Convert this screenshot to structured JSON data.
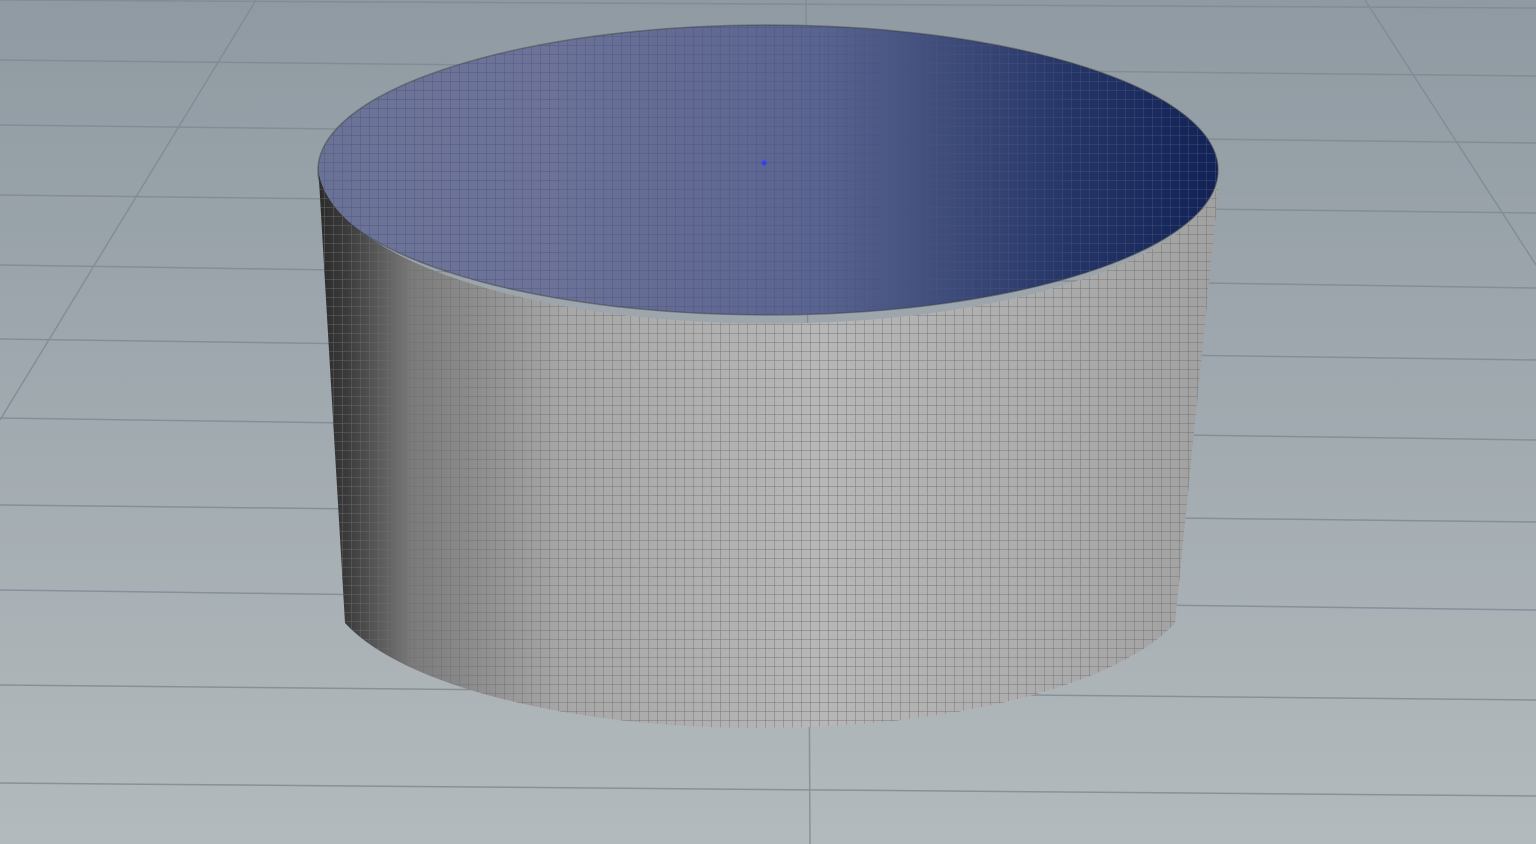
{
  "viewport": {
    "background_top": "#8f9aa2",
    "background_bottom": "#b3babd",
    "grid_color": "#7f8b93",
    "object": "open-cylinder",
    "object_outer_color": "#a8a8a8",
    "object_inner_color": "#4a5a8a",
    "wireframe_color": "#6e6e6e",
    "pivot_color": "#3a3aff"
  }
}
